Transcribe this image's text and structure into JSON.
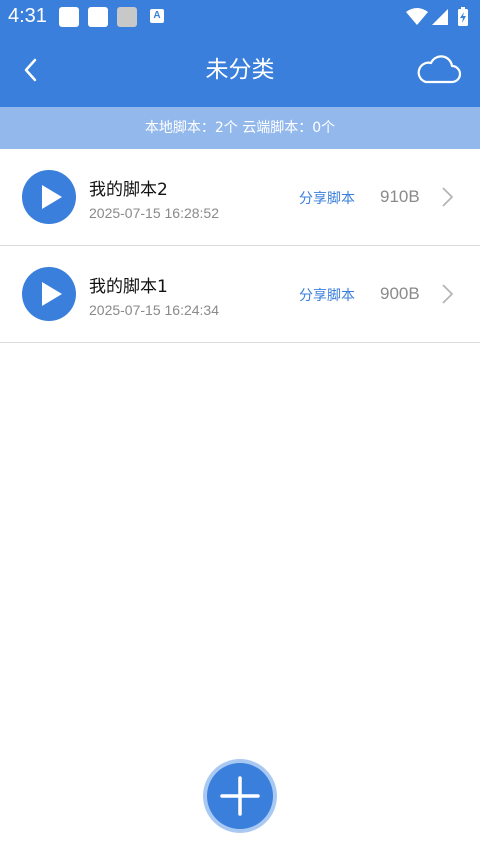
{
  "status_bar": {
    "time": "4:31",
    "notification_icons": [
      "app-notification-icon",
      "app-notification-icon",
      "app-notification-icon",
      "a-notification-icon"
    ],
    "notif_badge_letter": "A",
    "right_icons": [
      "wifi-icon",
      "signal-icon",
      "battery-charging-icon"
    ]
  },
  "app_bar": {
    "title": "未分类",
    "back_icon": "chevron-left-icon",
    "cloud_icon": "cloud-icon"
  },
  "summary": {
    "text": "本地脚本：2个 云端脚本：0个"
  },
  "scripts": [
    {
      "name": "我的脚本2",
      "timestamp": "2025-07-15 16:28:52",
      "share_label": "分享脚本",
      "size": "910B"
    },
    {
      "name": "我的脚本1",
      "timestamp": "2025-07-15 16:24:34",
      "share_label": "分享脚本",
      "size": "900B"
    }
  ],
  "fab": {
    "icon": "plus-icon"
  },
  "colors": {
    "primary": "#3a7fdb",
    "summary_bg": "#93b9ec",
    "fab_ring": "#a9c9f2",
    "secondary_text": "#8a8a8a",
    "divider": "#dcdcdc"
  }
}
